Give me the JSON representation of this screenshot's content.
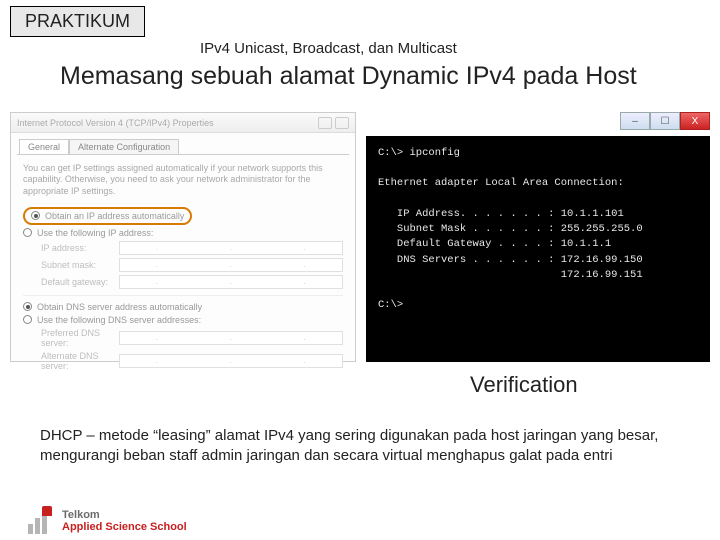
{
  "badge": "PRAKTIKUM",
  "subtitle": "IPv4 Unicast, Broadcast, dan Multicast",
  "title": "Memasang sebuah alamat Dynamic IPv4 pada Host",
  "dialog": {
    "window_title": "Internet Protocol Version 4 (TCP/IPv4) Properties",
    "tab_general": "General",
    "tab_alt": "Alternate Configuration",
    "intro": "You can get IP settings assigned automatically if your network supports this capability. Otherwise, you need to ask your network administrator for the appropriate IP settings.",
    "opt_auto": "Obtain an IP address automatically",
    "opt_manual": "Use the following IP address:",
    "lbl_ip": "IP address:",
    "lbl_mask": "Subnet mask:",
    "lbl_gw": "Default gateway:",
    "opt_dns_auto": "Obtain DNS server address automatically",
    "opt_dns_manual": "Use the following DNS server addresses:",
    "lbl_pref": "Preferred DNS server:",
    "lbl_alt": "Alternate DNS server:"
  },
  "console": {
    "prompt1": "C:\\> ipconfig",
    "header": "Ethernet adapter Local Area Connection:",
    "l_ip": "   IP Address. . . . . . . : 10.1.1.101",
    "l_mask": "   Subnet Mask . . . . . . : 255.255.255.0",
    "l_gw": "   Default Gateway . . . . : 10.1.1.1",
    "l_dns1": "   DNS Servers . . . . . . : 172.16.99.150",
    "l_dns2": "                             172.16.99.151",
    "prompt2": "C:\\>"
  },
  "verification": "Verification",
  "description": "DHCP – metode “leasing” alamat  IPv4 yang sering digunakan pada host jaringan yang besar, mengurangi beban staff admin jaringan dan secara virtual menghapus galat pada entri",
  "logo": {
    "line1": "Telkom",
    "line2": "Applied Science School"
  },
  "winbtn": {
    "min": "–",
    "max": "☐",
    "close": "X"
  }
}
